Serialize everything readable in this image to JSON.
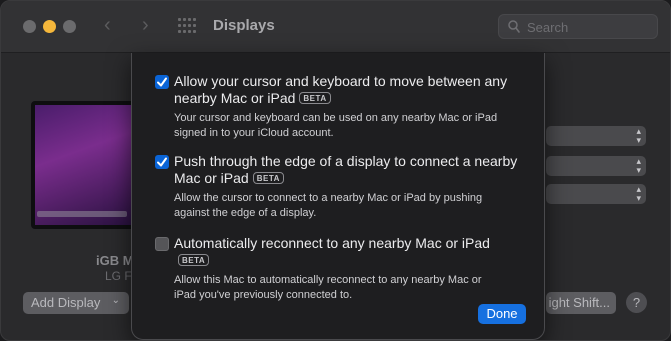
{
  "window": {
    "title": "Displays"
  },
  "search": {
    "placeholder": "Search"
  },
  "background": {
    "display_name": "iGB M",
    "display_sub": "LG F",
    "add_display_label": "Add Display",
    "night_shift_label": "ight Shift...",
    "help_label": "?"
  },
  "sheet": {
    "options": [
      {
        "checked": true,
        "label_line1": "Allow your cursor and keyboard to move between any",
        "label_line2": "nearby Mac or iPad",
        "badge": "BETA",
        "desc_line1": "Your cursor and keyboard can be used on any nearby Mac or iPad",
        "desc_line2": "signed in to your iCloud account."
      },
      {
        "checked": true,
        "label_line1": "Push through the edge of a display to connect a nearby",
        "label_line2": "Mac or iPad",
        "badge": "BETA",
        "desc_line1": "Allow the cursor to connect to a nearby Mac or iPad by pushing",
        "desc_line2": "against the edge of a display."
      },
      {
        "checked": false,
        "label_line1": "Automatically reconnect to any nearby Mac or iPad",
        "badge": "BETA",
        "desc_line1": "Allow this Mac to automatically reconnect to any nearby Mac or",
        "desc_line2": "iPad you've previously connected to."
      }
    ],
    "done_label": "Done"
  },
  "colors": {
    "accent": "#1670e0",
    "checkbox_on": "#0a64d6"
  }
}
